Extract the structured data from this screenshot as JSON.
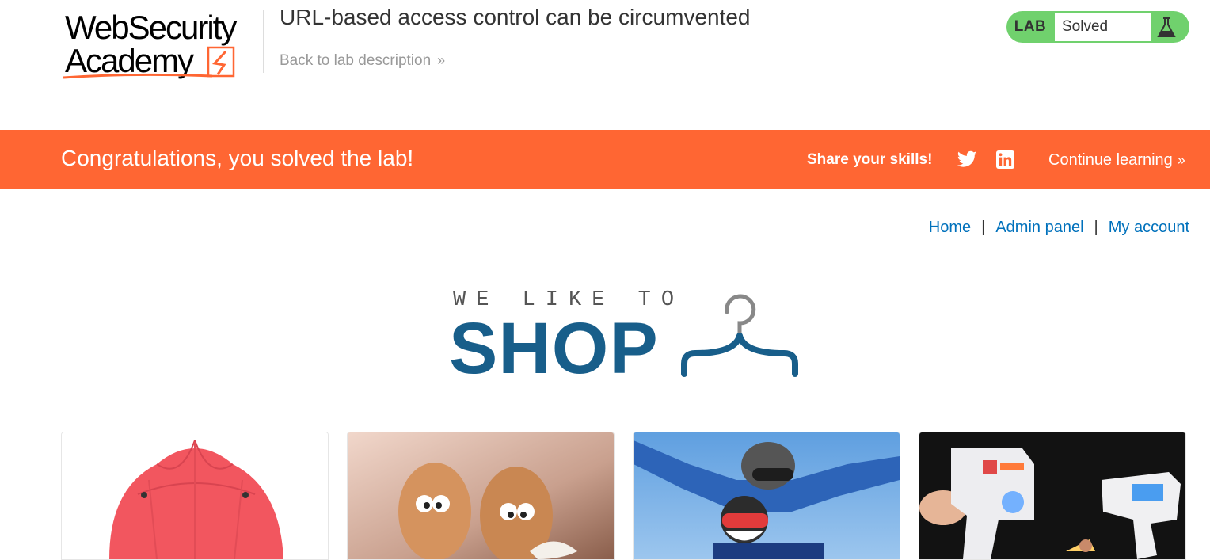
{
  "header": {
    "logo": {
      "line1": "WebSecurity",
      "line2": "Academy"
    },
    "lab_title": "URL-based access control can be circumvented",
    "back_link": "Back to lab description",
    "lab_badge": {
      "label": "LAB",
      "status": "Solved",
      "icon": "flask-icon"
    }
  },
  "banner": {
    "message": "Congratulations, you solved the lab!",
    "share_text": "Share your skills!",
    "continue_link": "Continue learning",
    "icons": [
      "twitter-icon",
      "linkedin-icon"
    ]
  },
  "nav": {
    "home": "Home",
    "separator": "|",
    "admin": "Admin panel",
    "account": "My account"
  },
  "shop_logo": {
    "tagline": "WE LIKE TO",
    "word": "SHOP",
    "icon": "hanger-icon"
  },
  "products": [
    {
      "image": "red umbrella"
    },
    {
      "image": "two eggs with eyes"
    },
    {
      "image": "tandem skydivers"
    },
    {
      "image": "toy laser guns"
    }
  ],
  "colors": {
    "banner": "#ff6633",
    "lab_badge": "#70d16d",
    "link": "#0071bc",
    "shop_blue": "#185e8a"
  }
}
